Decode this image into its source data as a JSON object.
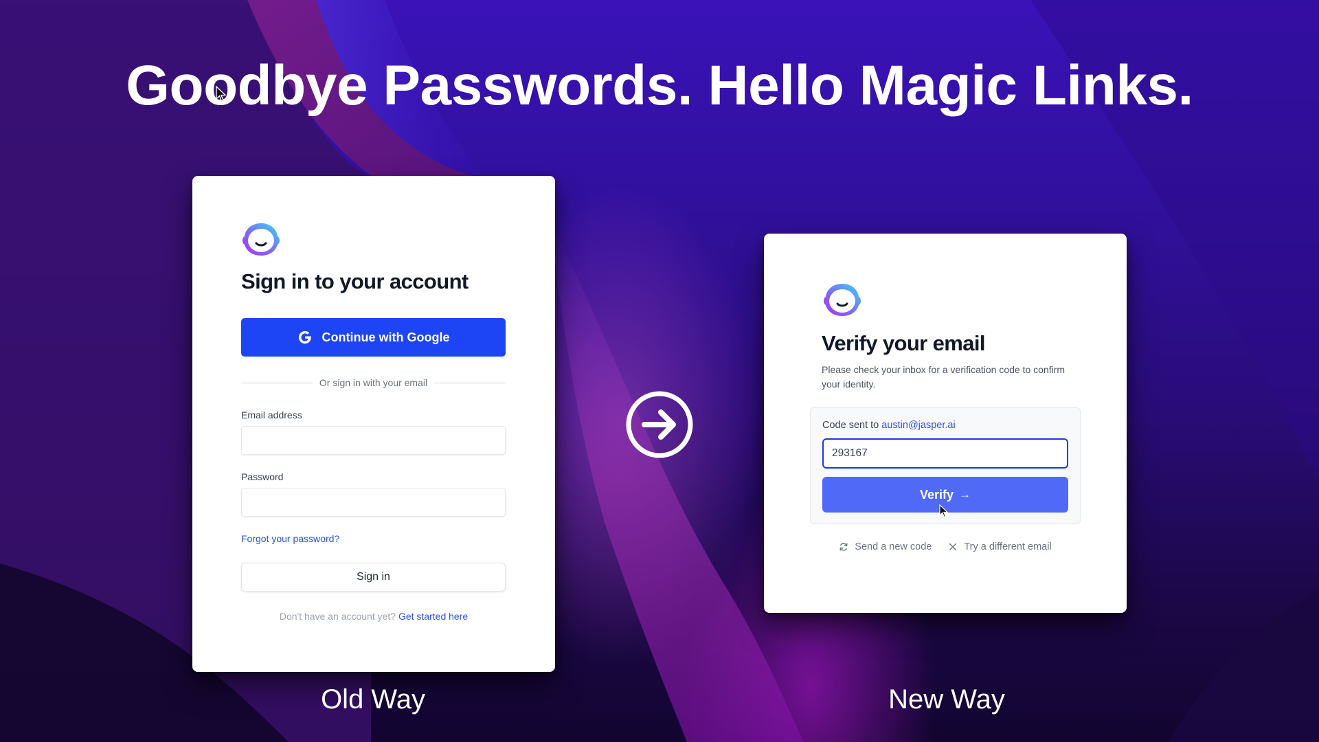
{
  "headline": "Goodbye Passwords. Hello Magic Links.",
  "colors": {
    "google_button": "#1d44f5",
    "verify_button": "#5069f7",
    "link": "#2f4ff0",
    "focused_input_border": "#1b3ae0",
    "title_text": "#111827"
  },
  "old_way": {
    "caption": "Old Way",
    "logo_icon": "jasper-logo-icon",
    "title": "Sign in to your account",
    "google_button": {
      "icon": "google-g-icon",
      "label": "Continue with Google"
    },
    "divider_text": "Or sign in with your email",
    "email_field": {
      "label": "Email address",
      "value": "",
      "placeholder": ""
    },
    "password_field": {
      "label": "Password",
      "value": "",
      "placeholder": ""
    },
    "forgot_link": "Forgot your password?",
    "signin_button": "Sign in",
    "signup_prompt": "Don't have an account yet?",
    "signup_link": "Get started here"
  },
  "transition": {
    "icon": "arrow-right-circle-icon"
  },
  "new_way": {
    "caption": "New Way",
    "logo_icon": "jasper-logo-icon",
    "title": "Verify your email",
    "subtitle": "Please check your inbox for a verification code to confirm your identity.",
    "code_sent_prefix": "Code sent to",
    "email": "austin@jasper.ai",
    "code_value": "293167",
    "verify_button": {
      "label": "Verify",
      "icon": "arrow-right-icon",
      "glyph": "→"
    },
    "actions": [
      {
        "icon": "refresh-icon",
        "label": "Send a new code"
      },
      {
        "icon": "close-icon",
        "label": "Try a different email"
      }
    ]
  }
}
